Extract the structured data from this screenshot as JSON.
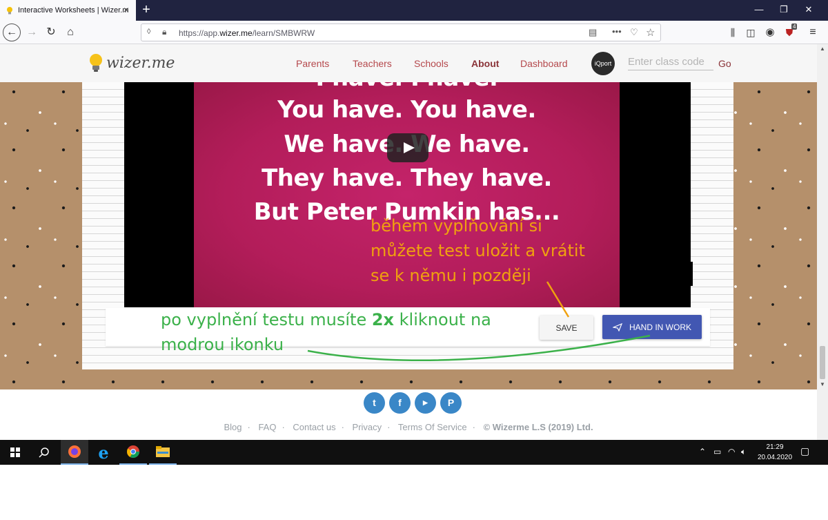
{
  "browser": {
    "tab_title": "Interactive Worksheets | Wizer.m",
    "url_prefix": "https://app.",
    "url_domain": "wizer.me",
    "url_path": "/learn/SMBWRW",
    "notification_count": "4"
  },
  "site": {
    "logo_text": "wizer.me",
    "nav": [
      "Parents",
      "Teachers",
      "Schools",
      "About",
      "Dashboard"
    ],
    "avatar_text": "iQport",
    "class_code_placeholder": "Enter class code",
    "go_label": "Go"
  },
  "video": {
    "lyrics": [
      "I have. I have.",
      "You have. You have.",
      "We have. We have.",
      "They have. They have.",
      "But Peter Pumkin has..."
    ]
  },
  "actions": {
    "save_label": "SAVE",
    "hand_in_label": "HAND IN WORK"
  },
  "annotations": {
    "orange_line1": "během vyplňování si",
    "orange_line2": "můžete test uložit a vrátit",
    "orange_line3": "se k němu i později",
    "green_line1_a": "po vyplnění testu musíte ",
    "green_line1_bold": "2x",
    "green_line1_b": " kliknout na",
    "green_line2": "modrou ikonku",
    "orange_color": "#f0a10f",
    "green_color": "#3bb14a"
  },
  "footer": {
    "social": [
      "twitter-icon",
      "facebook-icon",
      "youtube-icon",
      "pinterest-icon"
    ],
    "links": [
      "Blog",
      "FAQ",
      "Contact us",
      "Privacy",
      "Terms Of Service"
    ],
    "copyright": "© Wizerme L.S (2019) Ltd."
  },
  "taskbar": {
    "time": "21:29",
    "date": "20.04.2020"
  }
}
